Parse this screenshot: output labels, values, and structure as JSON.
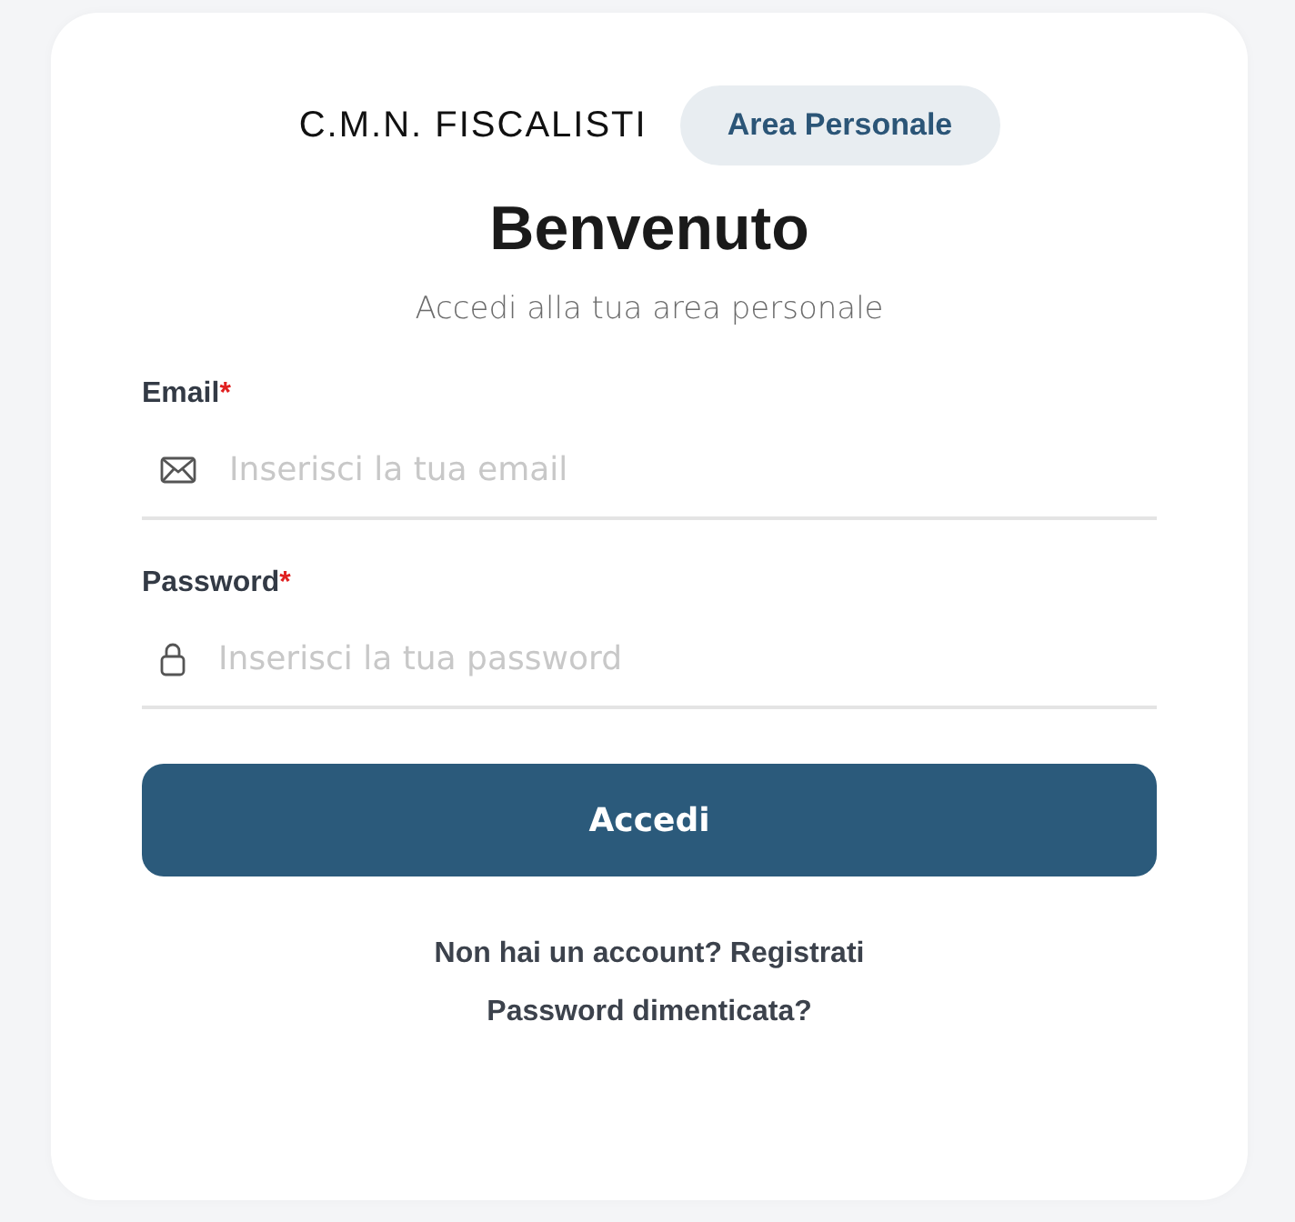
{
  "header": {
    "brand": "C.M.N. FISCALISTI",
    "badge": "Area Personale"
  },
  "title": "Benvenuto",
  "subtitle": "Accedi alla tua area personale",
  "fields": [
    {
      "kind": "email",
      "label": "Email",
      "required_mark": "*",
      "placeholder": "Inserisci la tua email"
    },
    {
      "kind": "password",
      "label": "Password",
      "required_mark": "*",
      "placeholder": "Inserisci la tua password"
    }
  ],
  "submit_button": "Accedi",
  "links": [
    "Non hai un account? Registrati",
    "Password dimenticata?"
  ]
}
